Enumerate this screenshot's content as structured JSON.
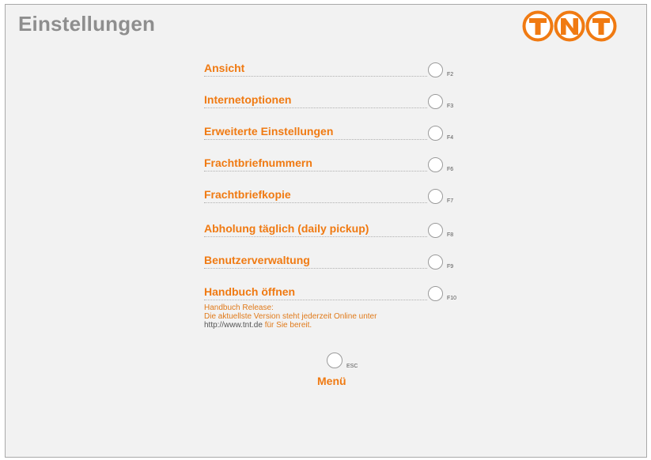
{
  "header": {
    "title": "Einstellungen",
    "logo_text": "TNT",
    "brand_color": "#f07a12"
  },
  "menu": {
    "items": [
      {
        "label": "Ansicht",
        "key": "F2"
      },
      {
        "label": "Internetoptionen",
        "key": "F3"
      },
      {
        "label": "Erweiterte Einstellungen",
        "key": "F4"
      },
      {
        "label": "Frachtbriefnummern",
        "key": "F6"
      },
      {
        "label": "Frachtbriefkopie",
        "key": "F7"
      },
      {
        "label": "Abholung täglich (daily pickup)",
        "key": "F8"
      },
      {
        "label": "Benutzerverwaltung",
        "key": "F9"
      },
      {
        "label": "Handbuch öffnen",
        "key": "F10"
      }
    ]
  },
  "release_note": {
    "line1": "Handbuch Release:",
    "line2": "Die aktuellste Version steht jederzeit Online unter",
    "url": "http://www.tnt.de",
    "suffix": " für Sie bereit."
  },
  "footer": {
    "menu_label": "Menü",
    "menu_key": "ESC"
  }
}
